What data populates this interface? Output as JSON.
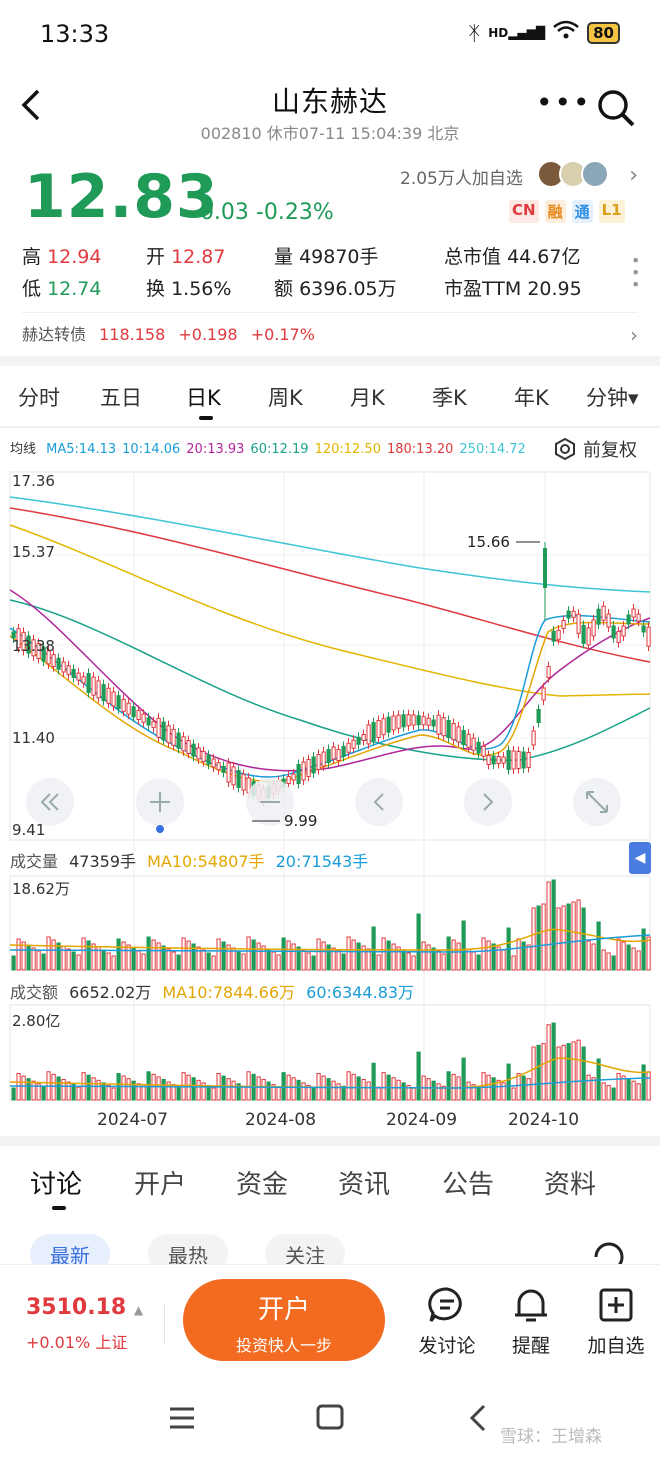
{
  "status": {
    "time": "13:33",
    "battery": "80",
    "network": "HD"
  },
  "header": {
    "title": "山东赫达",
    "subtitle": "002810 休市07-11 15:04:39 北京"
  },
  "quote": {
    "price": "12.83",
    "change": "-0.03 -0.23%",
    "watchers": "2.05万人加自选",
    "badges": [
      "CN",
      "融",
      "通",
      "L1"
    ],
    "stats": {
      "high_label": "高",
      "high": "12.94",
      "open_label": "开",
      "open": "12.87",
      "vol_label": "量",
      "vol": "49870手",
      "mcap_label": "总市值",
      "mcap": "44.67亿",
      "low_label": "低",
      "low": "12.74",
      "turn_label": "换",
      "turn": "1.56%",
      "amt_label": "额",
      "amt": "6396.05万",
      "pe_label": "市盈TTM",
      "pe": "20.95"
    },
    "bond": {
      "name": "赫达转债",
      "price": "118.158",
      "change": "+0.198",
      "pct": "+0.17%"
    }
  },
  "period_tabs": [
    "分时",
    "五日",
    "日K",
    "周K",
    "月K",
    "季K",
    "年K",
    "分钟▾"
  ],
  "ma_legend": {
    "prefix": "均线",
    "items": [
      {
        "label": "MA5:14.13",
        "color": "#1a9cd8"
      },
      {
        "label": "10:14.06",
        "color": "#1a9cd8"
      },
      {
        "label": "20:13.93",
        "color": "#b0269a"
      },
      {
        "label": "60:12.19",
        "color": "#1aa38a"
      },
      {
        "label": "120:12.50",
        "color": "#e3b500"
      },
      {
        "label": "180:13.20",
        "color": "#e0393e"
      },
      {
        "label": "250:14.72",
        "color": "#3fc4d4"
      }
    ],
    "adjust": "前复权"
  },
  "kline": {
    "y_ticks": [
      "17.36",
      "15.37",
      "13.38",
      "11.40",
      "9.41"
    ],
    "max_label": "15.66",
    "min_label": "9.99"
  },
  "volume": {
    "title": "成交量",
    "value": "47359手",
    "ma10": "MA10:54807手",
    "ma20": "20:71543手",
    "max": "18.62万"
  },
  "amount": {
    "title": "成交额",
    "value": "6652.02万",
    "ma10": "MA10:7844.66万",
    "ma60": "60:6344.83万",
    "max": "2.80亿"
  },
  "x_ticks": [
    "2024-07",
    "2024-08",
    "2024-09",
    "2024-10"
  ],
  "bottom_tabs": [
    "讨论",
    "开户",
    "资金",
    "资讯",
    "公告",
    "资料"
  ],
  "sub_tabs": [
    "最新",
    "最热",
    "关注"
  ],
  "footer": {
    "index_value": "3510.18",
    "index_change": "+0.01% 上证",
    "open_title": "开户",
    "open_sub": "投资快人一步",
    "actions": [
      "发讨论",
      "提醒",
      "加自选"
    ]
  },
  "watermark": "雪球：王增森"
}
